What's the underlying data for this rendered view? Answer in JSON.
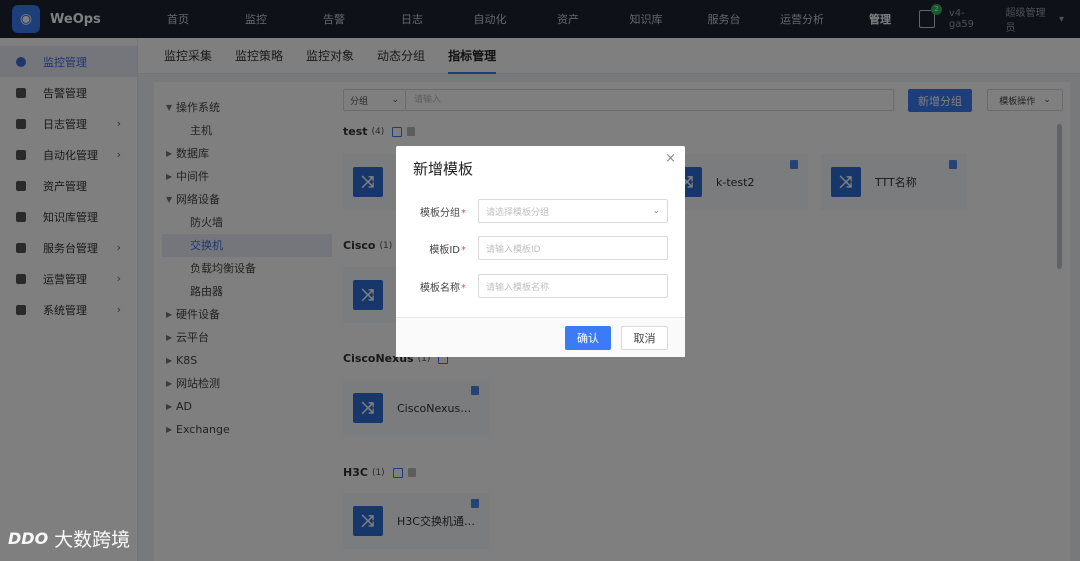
{
  "app": {
    "name": "WeOps"
  },
  "topnav": [
    "首页",
    "监控",
    "告警",
    "日志",
    "自动化",
    "资产",
    "知识库",
    "服务台",
    "运营分析",
    "管理"
  ],
  "topbar": {
    "notification_count": "2",
    "user": "v4-ga59",
    "role": "超级管理员"
  },
  "sidebar": {
    "items": [
      {
        "label": "监控管理",
        "chevron": ""
      },
      {
        "label": "告警管理",
        "chevron": ""
      },
      {
        "label": "日志管理",
        "chevron": "›"
      },
      {
        "label": "自动化管理",
        "chevron": "›"
      },
      {
        "label": "资产管理",
        "chevron": ""
      },
      {
        "label": "知识库管理",
        "chevron": ""
      },
      {
        "label": "服务台管理",
        "chevron": "›"
      },
      {
        "label": "运营管理",
        "chevron": "›"
      },
      {
        "label": "系统管理",
        "chevron": "›"
      }
    ]
  },
  "tabs": [
    "监控采集",
    "监控策略",
    "监控对象",
    "动态分组",
    "指标管理"
  ],
  "tree": {
    "nodes": [
      {
        "label": "操作系统",
        "arrow": "▼"
      },
      {
        "label": "主机"
      },
      {
        "label": "数据库",
        "arrow": "▶"
      },
      {
        "label": "中间件",
        "arrow": "▶"
      },
      {
        "label": "网络设备",
        "arrow": "▼"
      },
      {
        "label": "防火墙"
      },
      {
        "label": "交换机"
      },
      {
        "label": "负载均衡设备"
      },
      {
        "label": "路由器"
      },
      {
        "label": "硬件设备",
        "arrow": "▶"
      },
      {
        "label": "云平台",
        "arrow": "▶"
      },
      {
        "label": "K8S",
        "arrow": "▶"
      },
      {
        "label": "网站检测",
        "arrow": "▶"
      },
      {
        "label": "AD",
        "arrow": "▶"
      },
      {
        "label": "Exchange",
        "arrow": "▶"
      }
    ]
  },
  "filter": {
    "group_label": "分组",
    "search_placeholder": "请输入"
  },
  "buttons": {
    "add_group": "新增分组",
    "template_ops": "模板操作"
  },
  "groups": [
    {
      "name": "test",
      "count": "(4)"
    },
    {
      "name": "Cisco",
      "count": "(1)"
    },
    {
      "name": "CiscoNexus",
      "count": "(1)"
    },
    {
      "name": "H3C",
      "count": "(1)"
    }
  ],
  "cards": [
    "k-test2",
    "TTT名称",
    "CiscoNexus交...",
    "H3C交换机通用..."
  ],
  "modal": {
    "title": "新增模板",
    "close": "×",
    "fields": [
      {
        "label": "模板分组",
        "placeholder": "请选择模板分组"
      },
      {
        "label": "模板ID",
        "placeholder": "请输入模板ID"
      },
      {
        "label": "模板名称",
        "placeholder": "请输入模板名称"
      }
    ],
    "required_mark": "*",
    "ok": "确认",
    "cancel": "取消"
  },
  "watermark": {
    "logo": "DDO",
    "text": "大数跨境"
  },
  "colors": {
    "primary": "#3b7bf6",
    "topbar": "#1f2230"
  }
}
